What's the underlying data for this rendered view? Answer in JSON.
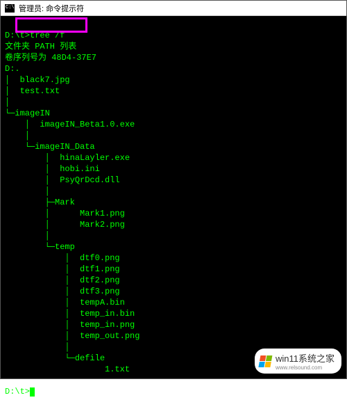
{
  "titlebar": {
    "text": "管理员: 命令提示符"
  },
  "terminal": {
    "prompt1": "D:\\t>tree /f",
    "line_folder_path": "文件夹 PATH 列表",
    "line_serial": "卷序列号为 48D4-37E7",
    "line_drive": "D:.",
    "root_files": [
      "│  black7.jpg",
      "│  test.txt",
      "│"
    ],
    "dir_imageIN": "└─imageIN",
    "file_beta": "    │  imageIN_Beta1.0.exe",
    "blank1": "    │",
    "dir_data": "    └─imageIN_Data",
    "data_files": [
      "        │  hinaLayler.exe",
      "        │  hobi.ini",
      "        │  PsyQrDcd.dll",
      "        │"
    ],
    "dir_mark": "        ├─Mark",
    "mark_files": [
      "        │      Mark1.png",
      "        │      Mark2.png",
      "        │"
    ],
    "dir_temp": "        └─temp",
    "temp_files": [
      "            │  dtf0.png",
      "            │  dtf1.png",
      "            │  dtf2.png",
      "            │  dtf3.png",
      "            │  tempA.bin",
      "            │  temp_in.bin",
      "            │  temp_in.png",
      "            │  temp_out.png",
      "            │"
    ],
    "dir_defile": "            └─defile",
    "defile_file": "                    1.txt",
    "blank2": "",
    "prompt2": "D:\\t>"
  },
  "watermark": {
    "text": "win11系统之家",
    "url": "www.relsound.com"
  }
}
